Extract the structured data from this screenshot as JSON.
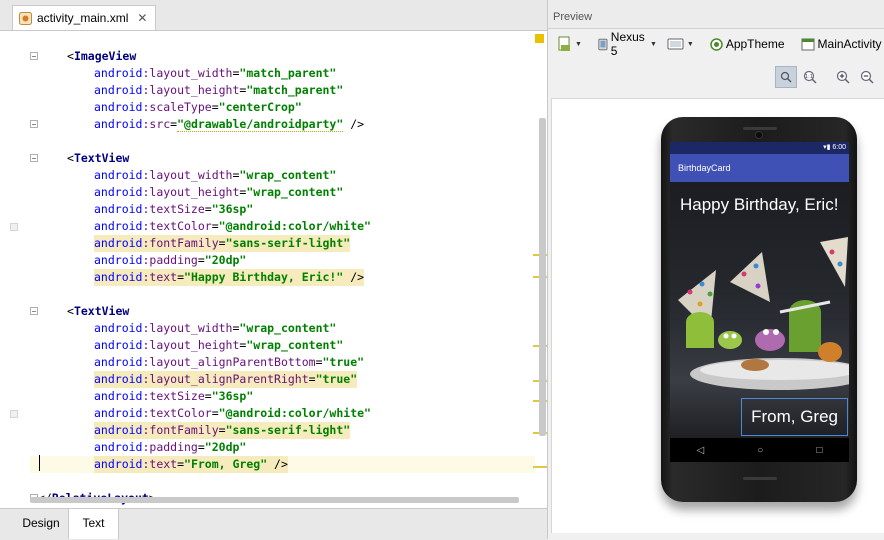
{
  "editor": {
    "file_tab": "activity_main.xml",
    "close_glyph": "✕",
    "bottom_tabs": [
      "Design",
      "Text"
    ],
    "active_bottom_tab": "Text"
  },
  "code_lines": [
    {
      "text": "<ImageView",
      "indent": 1
    },
    {
      "text": "android:layout_width=\"match_parent\"",
      "indent": 2
    },
    {
      "text": "android:layout_height=\"match_parent\"",
      "indent": 2
    },
    {
      "text": "android:scaleType=\"centerCrop\"",
      "indent": 2
    },
    {
      "text": "android:src=\"@drawable/androidparty\" />",
      "indent": 2
    },
    {
      "text": "",
      "indent": 0
    },
    {
      "text": "<TextView",
      "indent": 1
    },
    {
      "text": "android:layout_width=\"wrap_content\"",
      "indent": 2
    },
    {
      "text": "android:layout_height=\"wrap_content\"",
      "indent": 2
    },
    {
      "text": "android:textSize=\"36sp\"",
      "indent": 2
    },
    {
      "text": "android:textColor=\"@android:color/white\"",
      "indent": 2
    },
    {
      "text": "android:fontFamily=\"sans-serif-light\"",
      "indent": 2,
      "highlight": true
    },
    {
      "text": "android:padding=\"20dp\"",
      "indent": 2
    },
    {
      "text": "android:text=\"Happy Birthday, Eric!\" />",
      "indent": 2,
      "highlight": true
    },
    {
      "text": "",
      "indent": 0
    },
    {
      "text": "<TextView",
      "indent": 1
    },
    {
      "text": "android:layout_width=\"wrap_content\"",
      "indent": 2
    },
    {
      "text": "android:layout_height=\"wrap_content\"",
      "indent": 2
    },
    {
      "text": "android:layout_alignParentBottom=\"true\"",
      "indent": 2
    },
    {
      "text": "android:layout_alignParentRight=\"true\"",
      "indent": 2,
      "highlight": true
    },
    {
      "text": "android:textSize=\"36sp\"",
      "indent": 2
    },
    {
      "text": "android:textColor=\"@android:color/white\"",
      "indent": 2
    },
    {
      "text": "android:fontFamily=\"sans-serif-light\"",
      "indent": 2,
      "highlight": true
    },
    {
      "text": "android:padding=\"20dp\"",
      "indent": 2
    },
    {
      "text": "android:text=\"From, Greg\" />",
      "indent": 2,
      "highlight": true,
      "current": true
    },
    {
      "text": "",
      "indent": 0
    },
    {
      "text": "</RelativeLayout>",
      "indent": 0
    }
  ],
  "preview": {
    "title": "Preview",
    "device": "Nexus 5",
    "theme": "AppTheme",
    "activity": "MainActivity",
    "phone": {
      "status_time": "6:00",
      "app_title": "BirthdayCard",
      "greeting": "Happy Birthday, Eric!",
      "signature": "From, Greg",
      "nav_back": "◁",
      "nav_home": "○",
      "nav_recent": "□"
    }
  },
  "colors": {
    "tag": "#000080",
    "attribute": "#660e7a",
    "string": "#008000",
    "highlight": "#f6ebbc",
    "app_bar": "#3f51b5",
    "status_bar": "#1c2766"
  }
}
